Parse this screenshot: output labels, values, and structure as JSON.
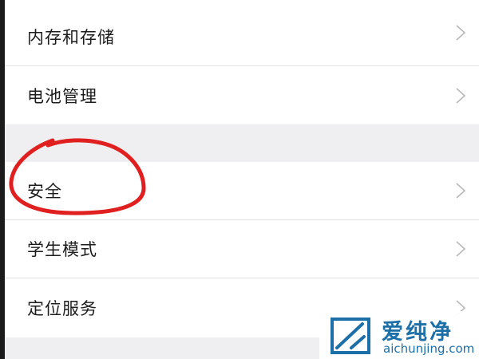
{
  "settings": {
    "items": [
      {
        "label": "内存和存储"
      },
      {
        "label": "电池管理"
      },
      {
        "label": "安全"
      },
      {
        "label": "学生模式"
      },
      {
        "label": "定位服务"
      }
    ]
  },
  "watermark": {
    "brand": "爱纯净",
    "url": "aichunjing.com"
  },
  "colors": {
    "annotation": "#e02020",
    "watermark_blue": "#1d6fa8",
    "chevron": "#b8b8b8"
  }
}
